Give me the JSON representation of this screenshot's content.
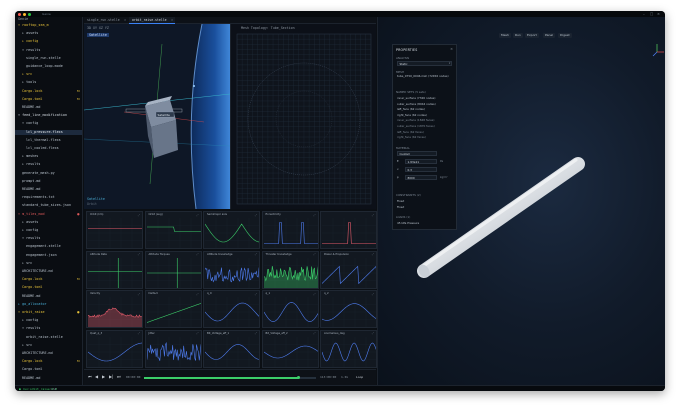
{
  "window": {
    "title": "Genie"
  },
  "sidebar": {
    "header": "Genie",
    "items": [
      {
        "label": "▾ rooftop_sea_m",
        "color": "#e8c33a",
        "indent": 0
      },
      {
        "label": "▸ assets",
        "color": "#b8c2cc",
        "indent": 1
      },
      {
        "label": "▸ config",
        "color": "#e8c33a",
        "indent": 1
      },
      {
        "label": "▾ results",
        "color": "#b8c2cc",
        "indent": 1
      },
      {
        "label": "single_run.stelle",
        "color": "#b8c2cc",
        "indent": 2
      },
      {
        "label": "guidance_loop.mode",
        "color": "#b8c2cc",
        "indent": 2
      },
      {
        "label": "▸ src",
        "color": "#e8c33a",
        "indent": 1
      },
      {
        "label": "▸ tools",
        "color": "#b8c2cc",
        "indent": 1
      },
      {
        "label": "Cargo.lock",
        "color": "#e8c33a",
        "indent": 1,
        "badge": "M"
      },
      {
        "label": "Cargo.toml",
        "color": "#e8c33a",
        "indent": 1,
        "badge": "M"
      },
      {
        "label": "README.md",
        "color": "#b8c2cc",
        "indent": 1
      },
      {
        "label": "▾ feed_line_modification",
        "color": "#d6dde4",
        "indent": 0
      },
      {
        "label": "▾ config",
        "color": "#b8c2cc",
        "indent": 1
      },
      {
        "label": "lcl_pressure.flexs",
        "color": "#e8edf2",
        "indent": 2,
        "selected": true
      },
      {
        "label": "lcl_thermal.flexs",
        "color": "#b8c2cc",
        "indent": 2
      },
      {
        "label": "lcl_cooled.flexs",
        "color": "#b8c2cc",
        "indent": 2
      },
      {
        "label": "▸ meshes",
        "color": "#b8c2cc",
        "indent": 1
      },
      {
        "label": "▸ results",
        "color": "#b8c2cc",
        "indent": 1
      },
      {
        "label": "generate_mesh.py",
        "color": "#b8c2cc",
        "indent": 1
      },
      {
        "label": "prompt.md",
        "color": "#b8c2cc",
        "indent": 1
      },
      {
        "label": "README.md",
        "color": "#b8c2cc",
        "indent": 1
      },
      {
        "label": "requirements.txt",
        "color": "#b8c2cc",
        "indent": 1
      },
      {
        "label": "standard_tube_sizes.json",
        "color": "#b8c2cc",
        "indent": 1
      },
      {
        "label": "▾ m_tiles_mod",
        "color": "#e05a5a",
        "indent": 0,
        "badge": "●"
      },
      {
        "label": "▸ assets",
        "color": "#b8c2cc",
        "indent": 1
      },
      {
        "label": "▸ config",
        "color": "#b8c2cc",
        "indent": 1
      },
      {
        "label": "▾ results",
        "color": "#b8c2cc",
        "indent": 1
      },
      {
        "label": "engagement.stelle",
        "color": "#b8c2cc",
        "indent": 2
      },
      {
        "label": "engagement.json",
        "color": "#b8c2cc",
        "indent": 2
      },
      {
        "label": "▸ src",
        "color": "#b8c2cc",
        "indent": 1
      },
      {
        "label": "ARCHITECTURE.md",
        "color": "#b8c2cc",
        "indent": 1
      },
      {
        "label": "Cargo.lock",
        "color": "#e8c33a",
        "indent": 1,
        "badge": "M"
      },
      {
        "label": "Cargo.toml",
        "color": "#e8c33a",
        "indent": 1
      },
      {
        "label": "README.md",
        "color": "#b8c2cc",
        "indent": 1
      },
      {
        "label": "▸ go_allocator",
        "color": "#4ab0d9",
        "indent": 0
      },
      {
        "label": "▾ orbit_raise",
        "color": "#e8c33a",
        "indent": 0,
        "badge": "●"
      },
      {
        "label": "▸ config",
        "color": "#b8c2cc",
        "indent": 1
      },
      {
        "label": "▾ results",
        "color": "#b8c2cc",
        "indent": 1
      },
      {
        "label": "orbit_raise.stelle",
        "color": "#b8c2cc",
        "indent": 2
      },
      {
        "label": "▸ src",
        "color": "#b8c2cc",
        "indent": 1
      },
      {
        "label": "ARCHITECTURE.md",
        "color": "#b8c2cc",
        "indent": 1
      },
      {
        "label": "Cargo.lock",
        "color": "#e8c33a",
        "indent": 1,
        "badge": "M"
      },
      {
        "label": "Cargo.toml",
        "color": "#b8c2cc",
        "indent": 1
      },
      {
        "label": "README.md",
        "color": "#b8c2cc",
        "indent": 1
      }
    ]
  },
  "tabs_left": [
    {
      "label": "single_run.stelle",
      "active": false
    },
    {
      "label": "orbit_raise.stelle",
      "active": true
    }
  ],
  "tabs_right": [
    {
      "label": "lcl_pressure.flexs",
      "active": true
    }
  ],
  "viewport": {
    "toolbar": "3D  XY  XZ  YZ",
    "selection_tag": "Satellite",
    "footer_line1": "Satellite",
    "footer_line2": "Orbit",
    "object_label": "Satellite",
    "grid_title": "Mesh Topology: Tube_Section"
  },
  "plots": [
    {
      "title": "Orbit (km)",
      "kind": "flat"
    },
    {
      "title": "Orbit (avg)",
      "kind": "step"
    },
    {
      "title": "Semimajor axis",
      "kind": "vee"
    },
    {
      "title": "Eccentricity",
      "kind": "spike"
    },
    {
      "title": "",
      "kind": "spike2"
    },
    {
      "title": "Altitude Rate",
      "kind": "flatmark"
    },
    {
      "title": "Attitude Torques",
      "kind": "cross"
    },
    {
      "title": "Attitude Knowledge",
      "kind": "noise"
    },
    {
      "title": "Thruster Knowledge",
      "kind": "noisegreen"
    },
    {
      "title": "Power & Propulsion",
      "kind": "ramps"
    },
    {
      "title": "Velocity",
      "kind": "redbump"
    },
    {
      "title": "Delta-V",
      "kind": "ramp"
    },
    {
      "title": "q_0",
      "kind": "sine"
    },
    {
      "title": "q_1",
      "kind": "sinebig"
    },
    {
      "title": "q_2",
      "kind": "sine2"
    },
    {
      "title": "Quat_q_3",
      "kind": "sineslow"
    },
    {
      "title": "Jitter",
      "kind": "noiseblue"
    },
    {
      "title": "Bit_Voltage_eff_1",
      "kind": "sinemid"
    },
    {
      "title": "Bit_Voltage_eff_2",
      "kind": "sinesmall"
    },
    {
      "title": "Anomalous_deg",
      "kind": "sinefast"
    }
  ],
  "playbar": {
    "time_left": "00:00:00",
    "time_right": "113:00:00",
    "speed": "1.0x",
    "loop_label": "Loop"
  },
  "right": {
    "toolbar": [
      "Mesh",
      "Run",
      "Export",
      "Panel",
      "Digest"
    ]
  },
  "properties": {
    "title": "PROPERTIES",
    "analysis_label": "ANALYSIS",
    "analysis_value": "Static",
    "mesh_label": "MESH",
    "mesh_value": "tube_0750_0046.msh (72456 nodes)",
    "named_sets_label": "NAMED SETS (5 sets)",
    "named_sets": [
      "inner_surface (7326 nodes)",
      "outer_surface (8044 nodes)",
      "left_face (62 nodes)",
      "right_face (62 nodes)",
      "inner_surface (1848 faces)",
      "outer_surface (1870 faces)",
      "left_face (62 faces)",
      "right_face (62 faces)"
    ],
    "material_label": "MATERIAL",
    "material_value": "Custom",
    "fields": [
      {
        "key": "E",
        "value": "1.93e11",
        "unit": "Pa"
      },
      {
        "key": "ν",
        "value": "0.3",
        "unit": ""
      },
      {
        "key": "ρ",
        "value": "8000",
        "unit": "kg/m³"
      }
    ],
    "constraints_label": "CONSTRAINTS (2)",
    "constraints": [
      "Fixed",
      "Fixed"
    ],
    "loads_label": "LOADS (1)",
    "loads": [
      "45 kPa Pressure"
    ]
  },
  "status": {
    "left": "● run:orbit_raise:2.0",
    "right": "LSP"
  },
  "colors": {
    "accent": "#3b82f6",
    "green": "#3ccf6a",
    "red": "#e35b6a",
    "blue": "#4f7df0",
    "yellow": "#e8c33a"
  }
}
